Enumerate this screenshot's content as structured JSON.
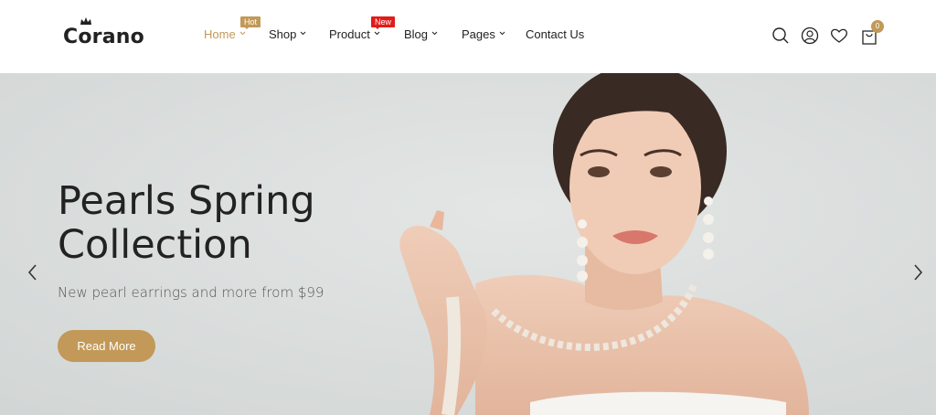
{
  "header": {
    "logo": "Corano",
    "nav": [
      {
        "label": "Home",
        "badge": "Hot",
        "active": true
      },
      {
        "label": "Shop"
      },
      {
        "label": "Product",
        "badge": "New"
      },
      {
        "label": "Blog"
      },
      {
        "label": "Pages"
      },
      {
        "label": "Contact Us"
      }
    ],
    "icons": [
      "search-icon",
      "user-icon",
      "heart-icon",
      "cart-icon"
    ],
    "cart_count": "0"
  },
  "hero": {
    "title_line1": "Pearls Spring",
    "title_line2": "Collection",
    "subtitle": "New pearl earrings and more from $99",
    "button": "Read More"
  },
  "colors": {
    "accent": "#c29958",
    "new_badge": "#e21b1b",
    "hero_bg": "#d9dcdb"
  }
}
